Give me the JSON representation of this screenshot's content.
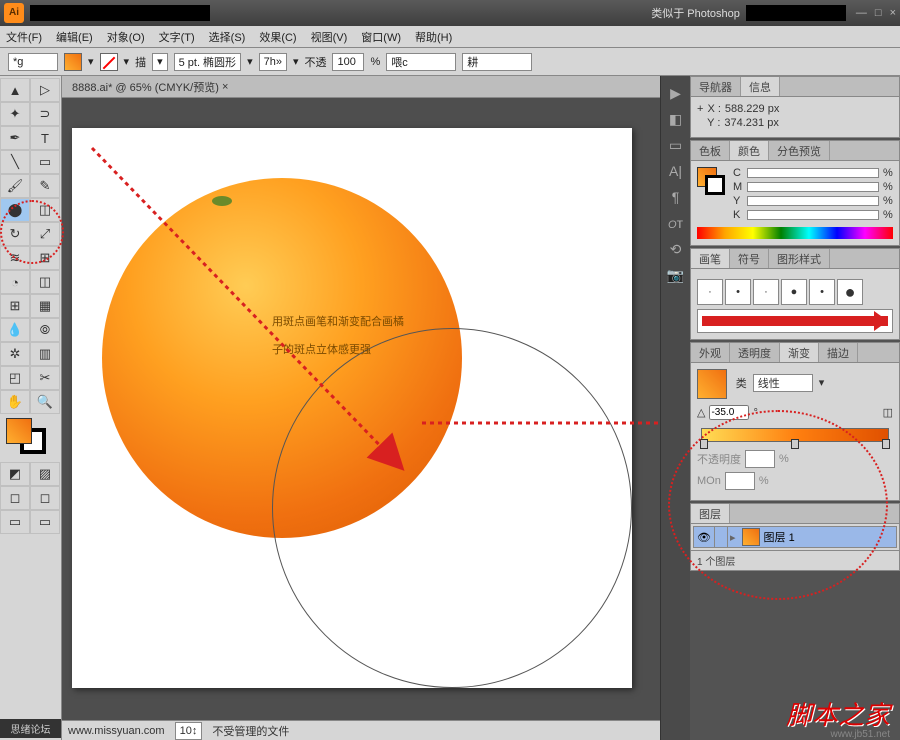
{
  "app": {
    "icon_text": "Ai",
    "workspace_label": "类似于 Photoshop"
  },
  "win_controls": {
    "min": "—",
    "max": "□",
    "close": "×"
  },
  "menu": {
    "file": "文件(F)",
    "edit": "编辑(E)",
    "object": "对象(O)",
    "type": "文字(T)",
    "select": "选择(S)",
    "effect": "效果(C)",
    "view": "视图(V)",
    "window": "窗口(W)",
    "help": "帮助(H)"
  },
  "optbar": {
    "name": "*g",
    "stroke_label": "描",
    "stroke_weight": "5 pt. 椭圆形",
    "profile": "7h»",
    "opacity_label": "不透",
    "opacity_val": "100",
    "pct": "%",
    "style1": "喂c",
    "style2": "耕"
  },
  "doc": {
    "tab": "8888.ai* @ 65% (CMYK/预览)",
    "close": "×"
  },
  "canvas": {
    "text_l1": "用斑点画笔和渐变配合画橘",
    "text_l2": "子的斑点立体感更强"
  },
  "status": {
    "site": "www.missyuan.com",
    "zoom": "10↕",
    "files": "不受管理的文件"
  },
  "info_panel": {
    "tab_nav": "导航器",
    "tab_info": "信息",
    "x_label": "X :",
    "x": "588.229 px",
    "y_label": "Y :",
    "y": "374.231 px"
  },
  "color_panel": {
    "tab_swatch": "色板",
    "tab_color": "颜色",
    "tab_sep": "分色预览",
    "c": "C",
    "m": "M",
    "y": "Y",
    "k": "K",
    "pct": "%"
  },
  "brush_panel": {
    "tab_brush": "画笔",
    "tab_symbol": "符号",
    "tab_gstyle": "图形样式"
  },
  "grad_panel": {
    "tab_appear": "外观",
    "tab_trans": "透明度",
    "tab_grad": "渐变",
    "tab_stroke": "描边",
    "type_label": "类",
    "type_val": "线性",
    "angle_val": "-35.0",
    "angle_deg": "°",
    "opacity_label": "不透明度",
    "pct": "%",
    "mid_label": "MOn"
  },
  "layers_panel": {
    "tab": "图层",
    "layer_name": "图层 1",
    "footer": "1 个图层"
  },
  "watermark": {
    "text": "脚本之家",
    "url": "www.jb51.net"
  },
  "toolbox_footer": "思绪论坛"
}
